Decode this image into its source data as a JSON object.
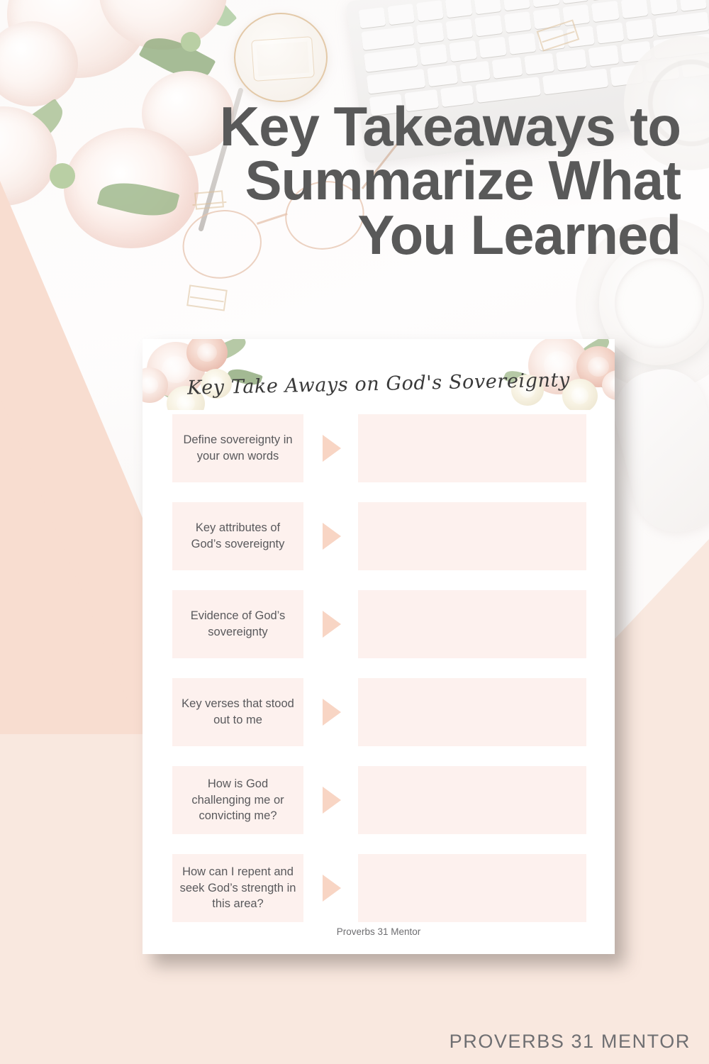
{
  "pin": {
    "title_lines": [
      "Key Takeaways to",
      "Summarize What",
      "You Learned"
    ],
    "brand": "PROVERBS 31 MENTOR"
  },
  "worksheet": {
    "title": "Key Take Aways on God's Sovereignty",
    "footer": "Proverbs 31 Mentor",
    "rows": [
      {
        "question": "Define sovereignty in your own words",
        "answer": ""
      },
      {
        "question": "Key attributes of God’s sovereignty",
        "answer": ""
      },
      {
        "question": "Evidence of God’s sovereignty",
        "answer": ""
      },
      {
        "question": "Key verses that stood out to me",
        "answer": ""
      },
      {
        "question": "How is God challenging me or convicting me?",
        "answer": ""
      },
      {
        "question": "How can I repent and seek God’s strength in this area?",
        "answer": ""
      }
    ]
  },
  "colors": {
    "page_background": "#f9e8df",
    "pink_overlay": "#f8ddd0",
    "box_fill": "#fdf1ee",
    "arrow": "#f8d5c4",
    "title_text": "#595959",
    "body_text": "#59595c",
    "sheet_white": "#ffffff"
  }
}
